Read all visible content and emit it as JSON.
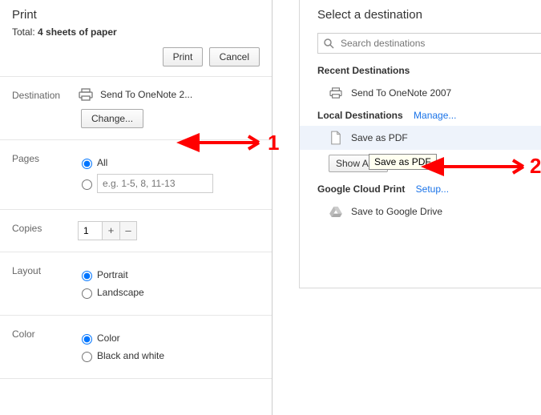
{
  "header": {
    "title": "Print",
    "total_prefix": "Total: ",
    "total_value": "4 sheets of paper",
    "print": "Print",
    "cancel": "Cancel"
  },
  "destination": {
    "label": "Destination",
    "current": "Send To OneNote 2...",
    "change": "Change..."
  },
  "pages": {
    "label": "Pages",
    "all": "All",
    "placeholder": "e.g. 1-5, 8, 11-13"
  },
  "copies": {
    "label": "Copies",
    "value": "1"
  },
  "layout": {
    "label": "Layout",
    "portrait": "Portrait",
    "landscape": "Landscape"
  },
  "color": {
    "label": "Color",
    "color": "Color",
    "bw": "Black and white"
  },
  "overlay": {
    "title": "Select a destination",
    "search_placeholder": "Search destinations",
    "recent_head": "Recent Destinations",
    "recent_item": "Send To OneNote 2007",
    "local_head": "Local Destinations",
    "manage": "Manage...",
    "save_pdf": "Save as PDF",
    "show_all": "Show All...",
    "tooltip": "Save as PDF",
    "gcp_head": "Google Cloud Print",
    "setup": "Setup...",
    "gdrive": "Save to Google Drive"
  },
  "arrows": {
    "one": "1",
    "two": "2"
  }
}
